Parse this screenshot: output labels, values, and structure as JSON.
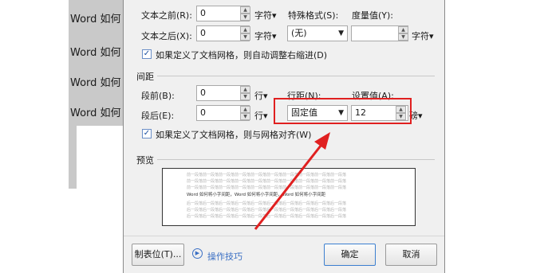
{
  "document": {
    "lines": [
      "Word 如何",
      "Word 如何",
      "Word 如何",
      "Word 如何"
    ]
  },
  "indent": {
    "before_label": "文本之前(R):",
    "before_value": "0",
    "before_unit": "字符▾",
    "after_label": "文本之后(X):",
    "after_value": "0",
    "after_unit": "字符▾",
    "special_label": "特殊格式(S):",
    "special_value": "(无)",
    "measure_label": "度量值(Y):",
    "measure_value": "",
    "measure_unit": "字符▾",
    "auto_adjust_label": "如果定义了文档网格，则自动调整右缩进(D)",
    "auto_adjust_checked": true
  },
  "spacing": {
    "section_title": "间距",
    "before_label": "段前(B):",
    "before_value": "0",
    "before_unit": "行▾",
    "after_label": "段后(E):",
    "after_value": "0",
    "after_unit": "行▾",
    "line_spacing_label": "行距(N):",
    "line_spacing_value": "固定值",
    "set_value_label": "设置值(A):",
    "set_value": "12",
    "set_value_unit": "磅▾",
    "snap_grid_label": "如果定义了文档网格，则与网格对齐(W)",
    "snap_grid_checked": true
  },
  "preview": {
    "section_title": "预览",
    "lines": [
      "前一段落前一段落前一段落前一段落前一段落前一段落前一段落前一段落前一段落前一段落",
      "前一段落前一段落前一段落前一段落前一段落前一段落前一段落前一段落前一段落前一段落",
      "前一段落前一段落前一段落前一段落前一段落前一段落前一段落前一段落前一段落前一段落",
      "Word 如何将小字间距，Word 如何将小字间距，Word 如何将小字间距",
      "后一段落后一段落后一段落后一段落后一段落后一段落后一段落后一段落后一段落后一段落",
      "后一段落后一段落后一段落后一段落后一段落后一段落后一段落后一段落后一段落后一段落",
      "后一段落后一段落后一段落后一段落后一段落后一段落后一段落后一段落后一段落后一段落"
    ]
  },
  "footer": {
    "tabs_button": "制表位(T)...",
    "tips_link": "操作技巧",
    "ok_button": "确定",
    "cancel_button": "取消"
  },
  "colors": {
    "highlight": "#e02020",
    "link": "#3a6fc4"
  }
}
